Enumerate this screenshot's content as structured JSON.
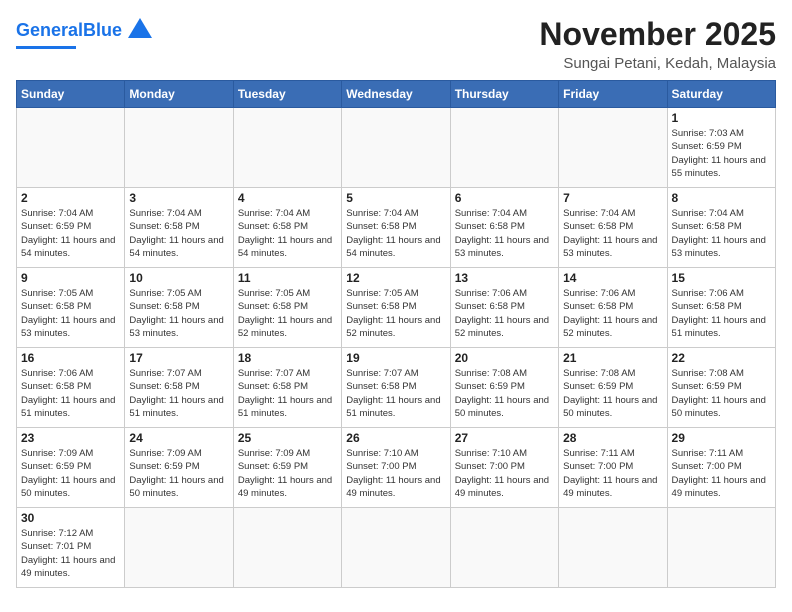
{
  "header": {
    "logo_general": "General",
    "logo_blue": "Blue",
    "month_title": "November 2025",
    "location": "Sungai Petani, Kedah, Malaysia"
  },
  "days_of_week": [
    "Sunday",
    "Monday",
    "Tuesday",
    "Wednesday",
    "Thursday",
    "Friday",
    "Saturday"
  ],
  "weeks": [
    [
      {
        "day": "",
        "info": ""
      },
      {
        "day": "",
        "info": ""
      },
      {
        "day": "",
        "info": ""
      },
      {
        "day": "",
        "info": ""
      },
      {
        "day": "",
        "info": ""
      },
      {
        "day": "",
        "info": ""
      },
      {
        "day": "1",
        "info": "Sunrise: 7:03 AM\nSunset: 6:59 PM\nDaylight: 11 hours\nand 55 minutes."
      }
    ],
    [
      {
        "day": "2",
        "info": "Sunrise: 7:04 AM\nSunset: 6:59 PM\nDaylight: 11 hours\nand 54 minutes."
      },
      {
        "day": "3",
        "info": "Sunrise: 7:04 AM\nSunset: 6:58 PM\nDaylight: 11 hours\nand 54 minutes."
      },
      {
        "day": "4",
        "info": "Sunrise: 7:04 AM\nSunset: 6:58 PM\nDaylight: 11 hours\nand 54 minutes."
      },
      {
        "day": "5",
        "info": "Sunrise: 7:04 AM\nSunset: 6:58 PM\nDaylight: 11 hours\nand 54 minutes."
      },
      {
        "day": "6",
        "info": "Sunrise: 7:04 AM\nSunset: 6:58 PM\nDaylight: 11 hours\nand 53 minutes."
      },
      {
        "day": "7",
        "info": "Sunrise: 7:04 AM\nSunset: 6:58 PM\nDaylight: 11 hours\nand 53 minutes."
      },
      {
        "day": "8",
        "info": "Sunrise: 7:04 AM\nSunset: 6:58 PM\nDaylight: 11 hours\nand 53 minutes."
      }
    ],
    [
      {
        "day": "9",
        "info": "Sunrise: 7:05 AM\nSunset: 6:58 PM\nDaylight: 11 hours\nand 53 minutes."
      },
      {
        "day": "10",
        "info": "Sunrise: 7:05 AM\nSunset: 6:58 PM\nDaylight: 11 hours\nand 53 minutes."
      },
      {
        "day": "11",
        "info": "Sunrise: 7:05 AM\nSunset: 6:58 PM\nDaylight: 11 hours\nand 52 minutes."
      },
      {
        "day": "12",
        "info": "Sunrise: 7:05 AM\nSunset: 6:58 PM\nDaylight: 11 hours\nand 52 minutes."
      },
      {
        "day": "13",
        "info": "Sunrise: 7:06 AM\nSunset: 6:58 PM\nDaylight: 11 hours\nand 52 minutes."
      },
      {
        "day": "14",
        "info": "Sunrise: 7:06 AM\nSunset: 6:58 PM\nDaylight: 11 hours\nand 52 minutes."
      },
      {
        "day": "15",
        "info": "Sunrise: 7:06 AM\nSunset: 6:58 PM\nDaylight: 11 hours\nand 51 minutes."
      }
    ],
    [
      {
        "day": "16",
        "info": "Sunrise: 7:06 AM\nSunset: 6:58 PM\nDaylight: 11 hours\nand 51 minutes."
      },
      {
        "day": "17",
        "info": "Sunrise: 7:07 AM\nSunset: 6:58 PM\nDaylight: 11 hours\nand 51 minutes."
      },
      {
        "day": "18",
        "info": "Sunrise: 7:07 AM\nSunset: 6:58 PM\nDaylight: 11 hours\nand 51 minutes."
      },
      {
        "day": "19",
        "info": "Sunrise: 7:07 AM\nSunset: 6:58 PM\nDaylight: 11 hours\nand 51 minutes."
      },
      {
        "day": "20",
        "info": "Sunrise: 7:08 AM\nSunset: 6:59 PM\nDaylight: 11 hours\nand 50 minutes."
      },
      {
        "day": "21",
        "info": "Sunrise: 7:08 AM\nSunset: 6:59 PM\nDaylight: 11 hours\nand 50 minutes."
      },
      {
        "day": "22",
        "info": "Sunrise: 7:08 AM\nSunset: 6:59 PM\nDaylight: 11 hours\nand 50 minutes."
      }
    ],
    [
      {
        "day": "23",
        "info": "Sunrise: 7:09 AM\nSunset: 6:59 PM\nDaylight: 11 hours\nand 50 minutes."
      },
      {
        "day": "24",
        "info": "Sunrise: 7:09 AM\nSunset: 6:59 PM\nDaylight: 11 hours\nand 50 minutes."
      },
      {
        "day": "25",
        "info": "Sunrise: 7:09 AM\nSunset: 6:59 PM\nDaylight: 11 hours\nand 49 minutes."
      },
      {
        "day": "26",
        "info": "Sunrise: 7:10 AM\nSunset: 7:00 PM\nDaylight: 11 hours\nand 49 minutes."
      },
      {
        "day": "27",
        "info": "Sunrise: 7:10 AM\nSunset: 7:00 PM\nDaylight: 11 hours\nand 49 minutes."
      },
      {
        "day": "28",
        "info": "Sunrise: 7:11 AM\nSunset: 7:00 PM\nDaylight: 11 hours\nand 49 minutes."
      },
      {
        "day": "29",
        "info": "Sunrise: 7:11 AM\nSunset: 7:00 PM\nDaylight: 11 hours\nand 49 minutes."
      }
    ],
    [
      {
        "day": "30",
        "info": "Sunrise: 7:12 AM\nSunset: 7:01 PM\nDaylight: 11 hours\nand 49 minutes."
      },
      {
        "day": "",
        "info": ""
      },
      {
        "day": "",
        "info": ""
      },
      {
        "day": "",
        "info": ""
      },
      {
        "day": "",
        "info": ""
      },
      {
        "day": "",
        "info": ""
      },
      {
        "day": "",
        "info": ""
      }
    ]
  ]
}
